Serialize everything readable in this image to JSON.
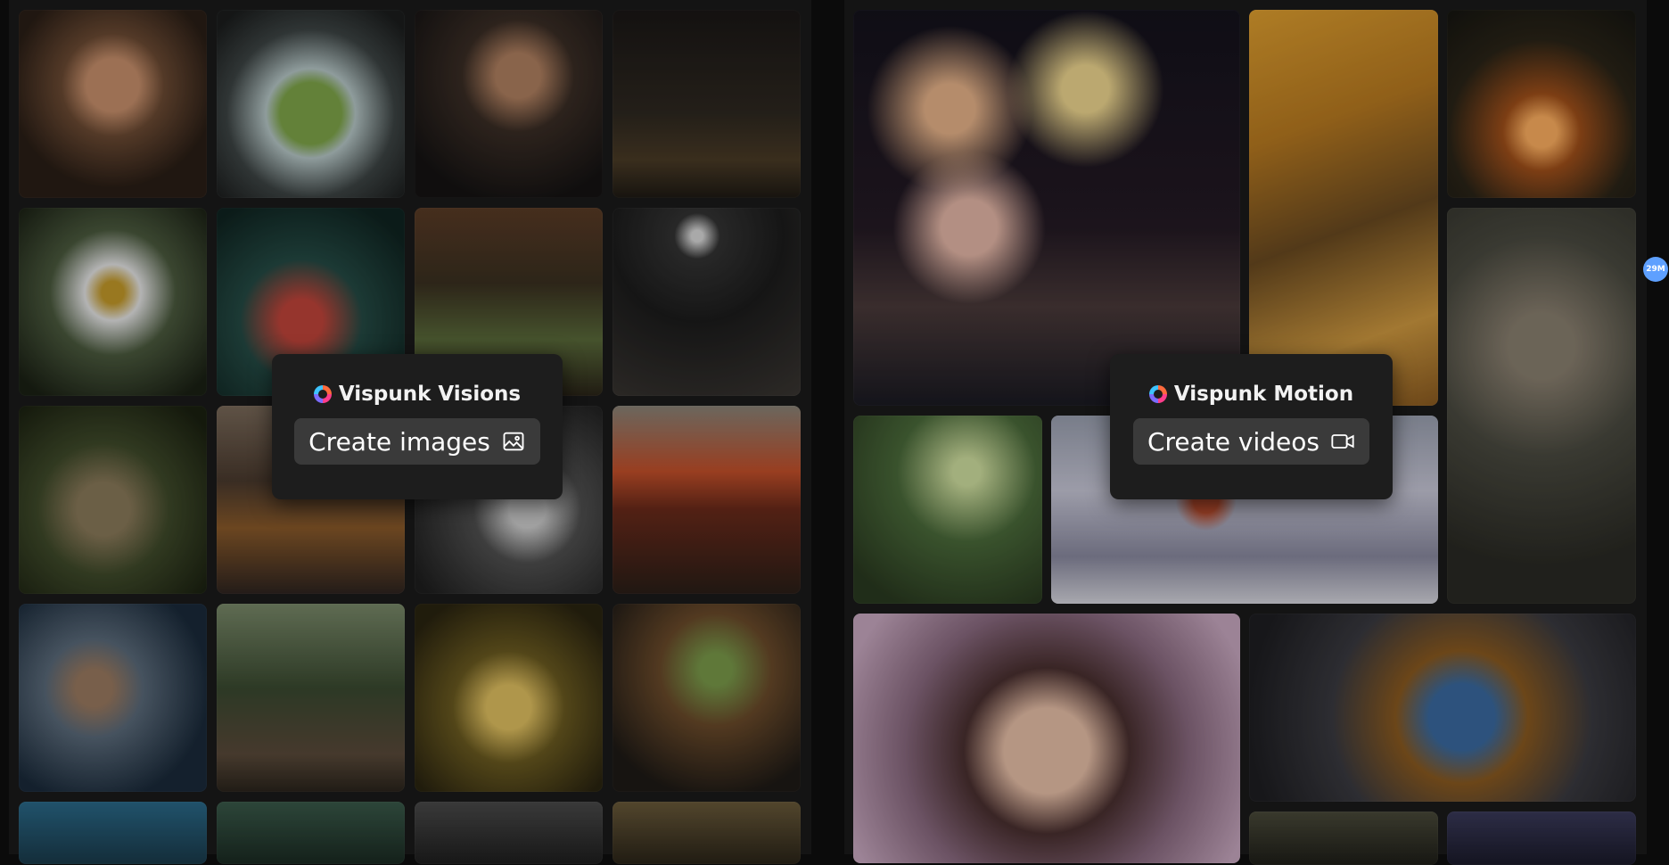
{
  "visions": {
    "title": "Vispunk Visions",
    "button_label": "Create images",
    "button_icon": "image-icon"
  },
  "motion": {
    "title": "Vispunk Motion",
    "button_label": "Create videos",
    "button_icon": "video-camera-icon"
  },
  "badge": {
    "label": "29M"
  },
  "colors": {
    "background": "#0b0b0b",
    "card": "#1d1d1d",
    "button": "#3a3a3a",
    "badge": "#5ea0ff"
  }
}
